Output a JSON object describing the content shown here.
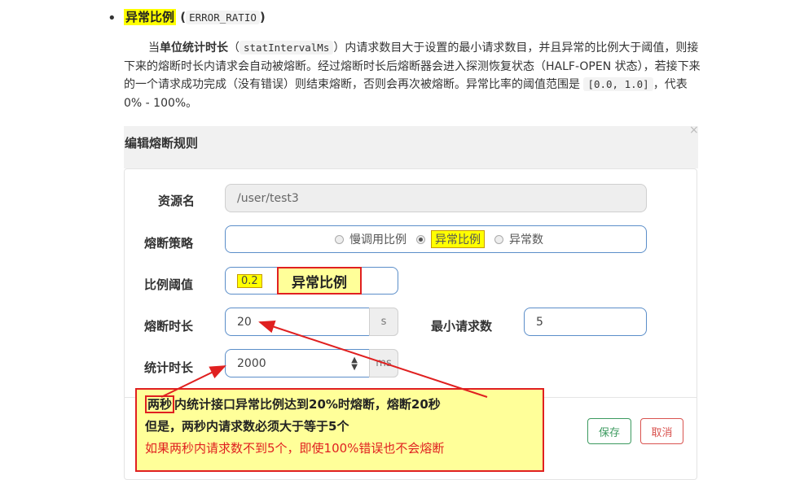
{
  "doc": {
    "bullet": "•",
    "heading_hl": "异常比例",
    "heading_paren_open": " (",
    "heading_code": "ERROR_RATIO",
    "heading_paren_close": ")",
    "para": {
      "p1": "当",
      "p2_bold": "单位统计时长",
      "p3": "（",
      "p4_code": "statIntervalMs",
      "p5": "）内请求数目大于设置的最小请求数目，并且异常的比例大于阈值，则接下来的熔断时长内请求会自动被熔断。经过熔断时长后熔断器会进入探测恢复状态（HALF-OPEN 状态），若接下来的一个请求成功完成（没有错误）则结束熔断，否则会再次被熔断。异常比率的阈值范围是 ",
      "p6_code": "[0.0, 1.0]",
      "p7": "，代表 0% - 100%。"
    }
  },
  "dialog": {
    "title": "编辑熔断规则",
    "close": "×",
    "resource_label": "资源名",
    "resource_value": "/user/test3",
    "strategy_label": "熔断策略",
    "strategy_options": [
      "慢调用比例",
      "异常比例",
      "异常数"
    ],
    "ratio_label": "比例阈值",
    "ratio_value": "0.2",
    "duration_label": "熔断时长",
    "duration_value": "20",
    "duration_unit": "s",
    "min_req_label": "最小请求数",
    "min_req_value": "5",
    "stat_label": "统计时长",
    "stat_value": "2000",
    "stat_unit": "ms",
    "save": "保存",
    "cancel": "取消"
  },
  "annotations": {
    "ratio_tag": "异常比例",
    "note_line1_boxed": "两秒",
    "note_line1_rest": "内统计接口异常比例达到20%时熔断，熔断20秒",
    "note_line2": "但是，两秒内请求数必须大于等于5个",
    "note_line3": "如果两秒内请求数不到5个，即使100%错误也不会熔断"
  },
  "colors": {
    "highlight": "#ffff00",
    "annotation_red": "#e02020",
    "field_border": "#5b8ec9",
    "save_green": "#3c9a5f",
    "cancel_red": "#d9534f"
  }
}
